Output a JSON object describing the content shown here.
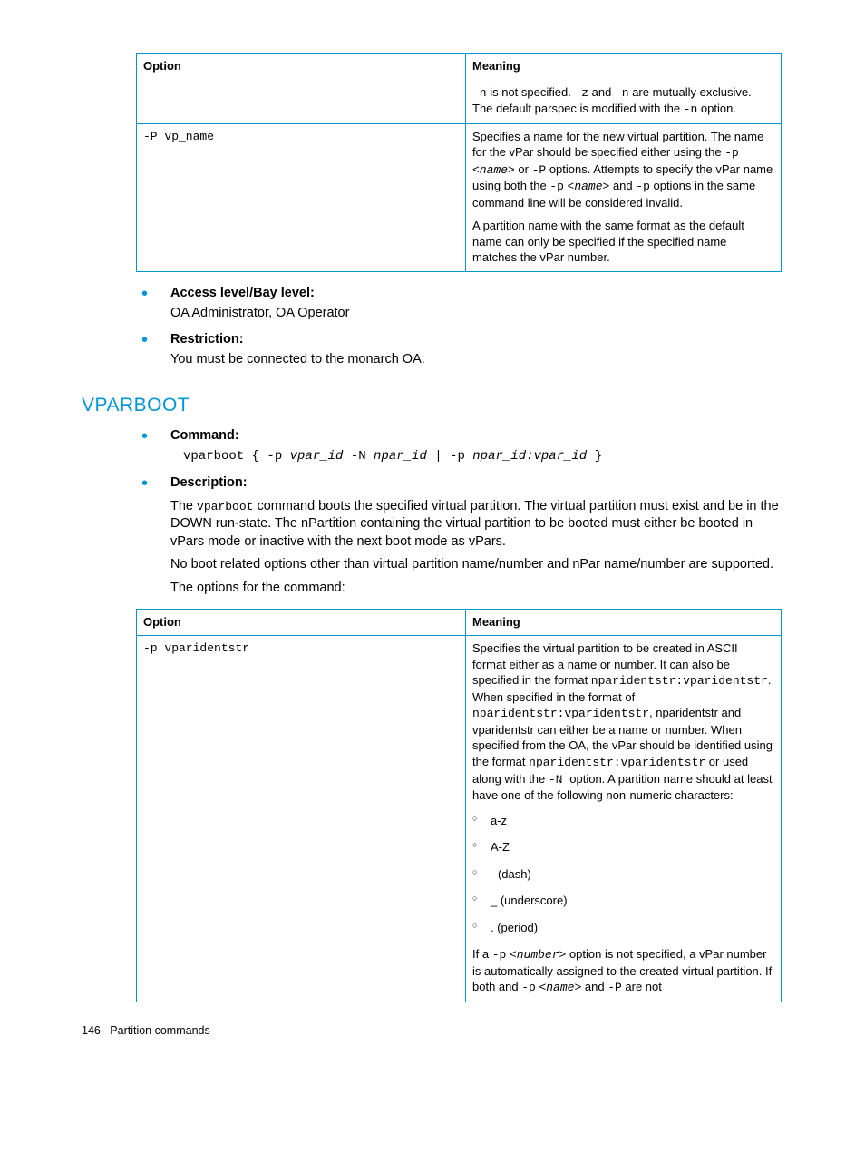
{
  "table1": {
    "headers": {
      "option": "Option",
      "meaning": "Meaning"
    },
    "row_prev": {
      "meaning_html": "<span class='code'>-n</span> is not specified. <span class='code'>-z</span> and <span class='code'>-n</span> are mutually exclusive. The default parspec is modified with the <span class='code'>-n</span> option."
    },
    "row_P": {
      "option": "-P vp_name",
      "p1_html": "Specifies a name for the new virtual partition. The name for the vPar should be specified either using the <span class='code'>-p</span> <span class='code italic'>&lt;name&gt;</span> or <span class='code'>-P</span> options. Attempts to specify the vPar name using both the <span class='code'>-p</span>&nbsp;<span class='code italic'>&lt;name&gt;</span> and <span class='code'>-p</span> options in the same command line will be considered invalid.",
      "p2": "A partition name with the same format as the default name can only be specified if the specified name matches the vPar number."
    }
  },
  "access": {
    "label": "Access level/Bay level:",
    "body": "OA Administrator, OA Operator"
  },
  "restriction": {
    "label": "Restriction:",
    "body": "You must be connected to the monarch OA."
  },
  "section_title": "VPARBOOT",
  "command": {
    "label": "Command:",
    "cmd_html": "vparboot { -p <span class='italic'>vpar_id</span> -N <span class='italic'>npar_id</span> | -p <span class='italic'>npar_id:vpar_id</span> }"
  },
  "description": {
    "label": "Description:",
    "p1_html": "The <span class='code'>vparboot</span> command boots the specified virtual partition. The virtual partition must exist and be in the DOWN run-state. The nPartition containing the virtual partition to be booted must either be booted in vPars mode or inactive with the next boot mode as vPars.",
    "p2": "No boot related options other than virtual partition name/number and nPar name/number are supported.",
    "p3": "The options for the command:"
  },
  "table2": {
    "headers": {
      "option": "Option",
      "meaning": "Meaning"
    },
    "row_p": {
      "option": "-p vparidentstr",
      "p1_html": "Specifies the virtual partition to be created in ASCII format either as a name or number. It can also be specified in the format <span class='code'>nparidentstr:vparidentstr</span>. When specified in the format of <span class='code'>nparidentstr:vparidentstr</span>, nparidentstr and vparidentstr can either be a name or number. When specified from the OA, the vPar should be identified using the format <span class='code'>nparidentstr:vparidentstr</span> or used along with the <span class='code'>-N </span> option. A partition name should at least have one of the following non-numeric characters:",
      "items": [
        "a-z",
        "A-Z",
        "- (dash)",
        "_ (underscore)",
        ". (period)"
      ],
      "p2_html": "If a <span class='code'>-p</span>&nbsp;<span class='code italic'>&lt;number&gt;</span> option is not specified, a vPar number is automatically assigned to the created virtual partition. If both and <span class='code'>-p</span>&nbsp;<span class='code italic'>&lt;name&gt;</span> and <span class='code'>-P</span> are not"
    }
  },
  "footer": {
    "page": "146",
    "title": "Partition commands"
  }
}
